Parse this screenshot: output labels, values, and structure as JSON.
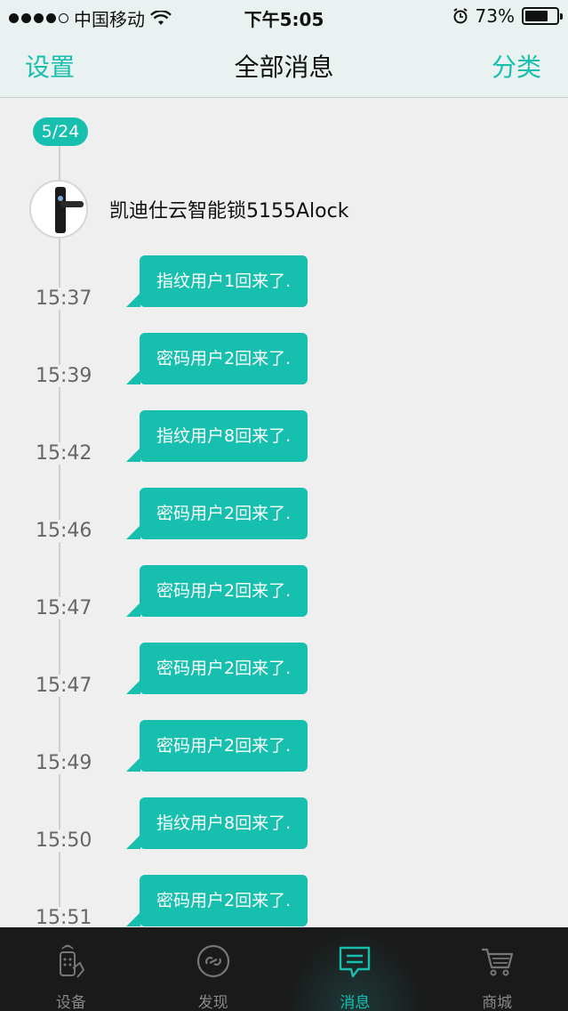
{
  "status_bar": {
    "carrier": "中国移动",
    "time": "下午5:05",
    "battery_percent": "73%",
    "battery_level": 0.73
  },
  "nav": {
    "left": "设置",
    "title": "全部消息",
    "right": "分类"
  },
  "date_badge": "5/24",
  "device": {
    "name": "凯迪仕云智能锁5155Alock"
  },
  "messages": [
    {
      "time": "15:37",
      "text": "指纹用户1回来了."
    },
    {
      "time": "15:39",
      "text": "密码用户2回来了."
    },
    {
      "time": "15:42",
      "text": "指纹用户8回来了."
    },
    {
      "time": "15:46",
      "text": "密码用户2回来了."
    },
    {
      "time": "15:47",
      "text": "密码用户2回来了."
    },
    {
      "time": "15:47",
      "text": "密码用户2回来了."
    },
    {
      "time": "15:49",
      "text": "密码用户2回来了."
    },
    {
      "time": "15:50",
      "text": "指纹用户8回来了."
    },
    {
      "time": "15:51",
      "text": "密码用户2回来了."
    }
  ],
  "tabs": [
    {
      "label": "设备",
      "icon": "device-remote-icon"
    },
    {
      "label": "发现",
      "icon": "discover-link-icon"
    },
    {
      "label": "消息",
      "icon": "message-icon"
    },
    {
      "label": "商城",
      "icon": "cart-icon"
    }
  ],
  "colors": {
    "accent": "#17c0ae",
    "tab_bar": "#1a1a1a",
    "background": "#efefef"
  }
}
